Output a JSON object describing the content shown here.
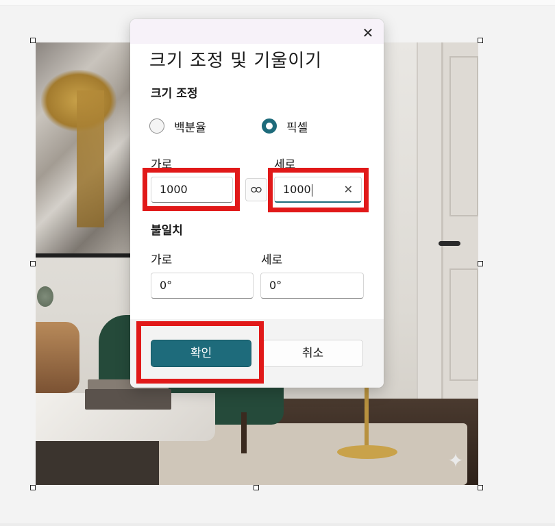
{
  "dialog": {
    "title": "크기 조정 및 기울이기",
    "resize_section": "크기 조정",
    "radio_percent": "백분율",
    "radio_pixel": "픽셀",
    "selected_unit": "픽셀",
    "width_label": "가로",
    "height_label": "세로",
    "width_value": "1000",
    "height_value": "1000",
    "aspect_lock": "link-icon",
    "skew_section": "불일치",
    "skew_h_label": "가로",
    "skew_v_label": "세로",
    "skew_h_value": "0°",
    "skew_v_value": "0°",
    "ok_label": "확인",
    "cancel_label": "취소",
    "close_icon": "close-icon"
  },
  "colors": {
    "accent": "#1e6b7b",
    "highlight": "#e11919"
  },
  "canvas": {
    "sparkle_icon": "sparkle-icon"
  }
}
